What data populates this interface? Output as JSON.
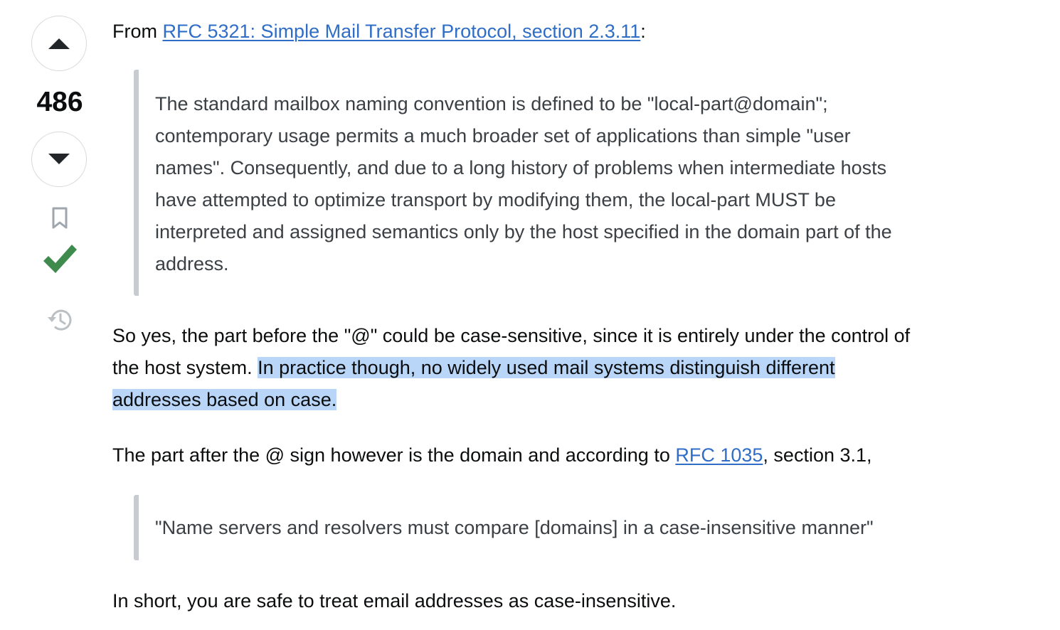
{
  "vote": {
    "score": "486",
    "accepted_color": "#3f8a4d"
  },
  "icons": {
    "upvote": "triangle-up-icon",
    "downvote": "triangle-down-icon",
    "bookmark": "bookmark-icon",
    "accepted": "checkmark-icon",
    "history": "history-icon"
  },
  "post": {
    "p1": {
      "prefix": "From ",
      "link": "RFC 5321: Simple Mail Transfer Protocol, section 2.3.11",
      "suffix": ":"
    },
    "quote1": {
      "lines": [
        "The standard mailbox naming convention is defined to be \"local-part@domain\";",
        "contemporary usage permits a much broader set of applications than simple \"user",
        "names\". Consequently, and due to a long history of problems when intermediate hosts",
        "have attempted to optimize transport by modifying them, the local-part MUST be",
        "interpreted and assigned semantics only by the host specified in the domain part of the",
        "address."
      ]
    },
    "p2": {
      "line1": "So yes, the part before the \"@\" could be case-sensitive, since it is entirely under the control of",
      "line2_plain": "the host system. ",
      "line2_highlight": "In practice though, no widely used mail systems distinguish different",
      "line3_highlight": "addresses based on case."
    },
    "p3": {
      "prefix": "The part after the @ sign however is the domain and according to ",
      "link": "RFC 1035",
      "suffix": ", section 3.1,"
    },
    "quote2": {
      "text": "\"Name servers and resolvers must compare [domains] in a case-insensitive manner\""
    },
    "p4": {
      "text": "In short, you are safe to treat email addresses as case-insensitive."
    }
  }
}
